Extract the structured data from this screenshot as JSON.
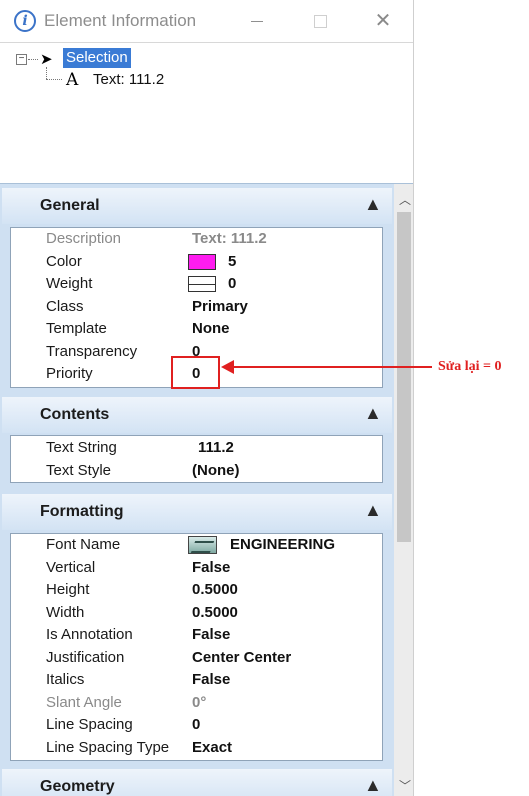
{
  "window": {
    "title": "Element Information",
    "info_glyph": "i",
    "close_glyph": "✕"
  },
  "tree": {
    "expand_glyph": "⊟",
    "selection_label": "Selection",
    "child_glyph": "A",
    "child_label": "Text:  111.2"
  },
  "sections": {
    "general": {
      "title": "General",
      "rows": [
        {
          "key": "Description",
          "value": "Text:  111.2"
        },
        {
          "key": "Color",
          "value": "5"
        },
        {
          "key": "Weight",
          "value": "0"
        },
        {
          "key": "Class",
          "value": "Primary"
        },
        {
          "key": "Template",
          "value": "None"
        },
        {
          "key": "Transparency",
          "value": "0"
        },
        {
          "key": "Priority",
          "value": "0"
        }
      ]
    },
    "contents": {
      "title": "Contents",
      "rows": [
        {
          "key": "Text String",
          "value": "111.2"
        },
        {
          "key": "Text Style",
          "value": "(None)"
        }
      ]
    },
    "formatting": {
      "title": "Formatting",
      "rows": [
        {
          "key": "Font Name",
          "value": "ENGINEERING"
        },
        {
          "key": "Vertical",
          "value": "False"
        },
        {
          "key": "Height",
          "value": "0.5000"
        },
        {
          "key": "Width",
          "value": "0.5000"
        },
        {
          "key": "Is Annotation",
          "value": "False"
        },
        {
          "key": "Justification",
          "value": "Center Center"
        },
        {
          "key": "Italics",
          "value": "False"
        },
        {
          "key": "Slant Angle",
          "value": "0°"
        },
        {
          "key": "Line Spacing",
          "value": "0"
        },
        {
          "key": "Line Spacing Type",
          "value": "Exact"
        }
      ]
    },
    "geometry": {
      "title": "Geometry"
    }
  },
  "chevron_glyph": "▲",
  "annotation": {
    "text": "Sửa lại = 0"
  },
  "colors": {
    "element_color": "#ff1cf0",
    "annotation_red": "#e02020",
    "selection_blue": "#3a7bd5"
  }
}
